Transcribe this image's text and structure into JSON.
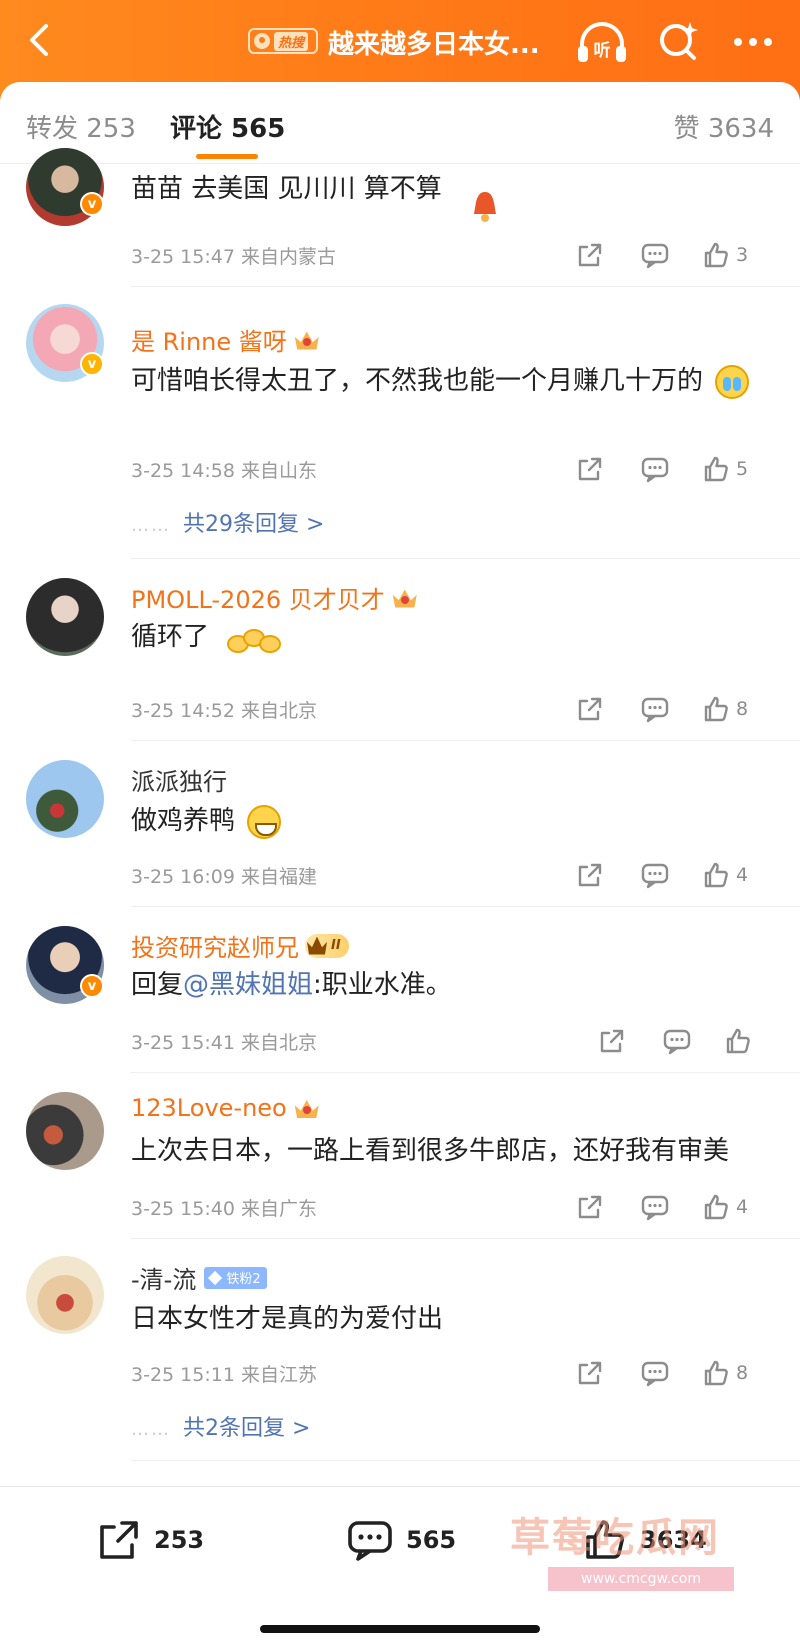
{
  "header": {
    "hot_label": "热搜",
    "title": "越来越多日本女...",
    "listen_label": "听"
  },
  "tabs": {
    "repost": "转发 253",
    "comment": "评论 565",
    "like": "赞 3634"
  },
  "comments": [
    {
      "name": "",
      "text": "苗苗 去美国 见川川 算不算",
      "time": "3-25 15:47 来自内蒙古",
      "likes": "3"
    },
    {
      "name": "是 Rinne 酱呀",
      "text": "可惜咱长得太丑了，不然我也能一个月赚几十万的",
      "time": "3-25 14:58 来自山东",
      "likes": "5",
      "replies": "共29条回复 >"
    },
    {
      "name": "PMOLL-2026 贝才贝才",
      "text": "循环了",
      "time": "3-25 14:52 来自北京",
      "likes": "8"
    },
    {
      "name": "派派独行",
      "text": "做鸡养鸭",
      "time": "3-25 16:09 来自福建",
      "likes": "4"
    },
    {
      "name": "投资研究赵师兄",
      "vip": "II",
      "text_prefix": "回复",
      "mention": "@黑妹姐姐",
      "text_suffix": ":职业水准。",
      "time": "3-25 15:41 来自北京",
      "likes": ""
    },
    {
      "name": "123Love-neo",
      "text": "上次去日本，一路上看到很多牛郎店，还好我有审美",
      "time": "3-25 15:40 来自广东",
      "likes": "4"
    },
    {
      "name": "-清-流",
      "fan_badge": "铁粉2",
      "text": "日本女性才是真的为爱付出",
      "time": "3-25 15:11 来自江苏",
      "likes": "8",
      "replies": "共2条回复 >"
    }
  ],
  "replies_dots": "……",
  "bottom": {
    "share_count": "253",
    "comment_count": "565",
    "like_count": "3634"
  },
  "watermark": {
    "text": "草莓吃瓜网",
    "url": "www.cmcgw.com"
  },
  "colors": {
    "header_orange": "#ff7a18",
    "name_orange": "#f2731a",
    "link_blue": "#5174b3",
    "meta_gray": "#9a9a9a"
  }
}
